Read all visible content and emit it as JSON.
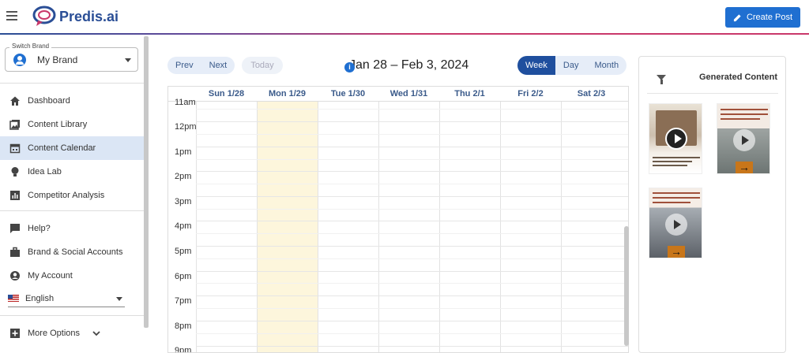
{
  "header": {
    "brand": "Predis.ai",
    "create_post": "Create Post"
  },
  "sidebar": {
    "switch_label": "Switch Brand",
    "brand": "My Brand",
    "items": [
      {
        "label": "Dashboard",
        "icon": "home-icon"
      },
      {
        "label": "Content Library",
        "icon": "image-library-icon"
      },
      {
        "label": "Content Calendar",
        "icon": "calendar-icon",
        "active": true
      },
      {
        "label": "Idea Lab",
        "icon": "lightbulb-icon"
      },
      {
        "label": "Competitor Analysis",
        "icon": "analytics-icon"
      },
      {
        "label": "Help?",
        "icon": "chat-icon"
      },
      {
        "label": "Brand & Social Accounts",
        "icon": "briefcase-icon"
      },
      {
        "label": "My Account",
        "icon": "account-icon"
      }
    ],
    "language": "English",
    "more_options": "More Options"
  },
  "calendar": {
    "prev": "Prev",
    "next": "Next",
    "today": "Today",
    "title": "Jan 28 – Feb 3, 2024",
    "views": [
      "Week",
      "Day",
      "Month"
    ],
    "active_view": "Week",
    "days": [
      "Sun 1/28",
      "Mon 1/29",
      "Tue 1/30",
      "Wed 1/31",
      "Thu 2/1",
      "Fri 2/2",
      "Sat 2/3"
    ],
    "today_day": "Mon 1/29",
    "times": [
      "11am",
      "12pm",
      "1pm",
      "2pm",
      "3pm",
      "4pm",
      "5pm",
      "6pm",
      "7pm",
      "8pm",
      "9pm"
    ]
  },
  "panel": {
    "title": "Generated Content"
  },
  "colors": {
    "accent": "#1f6fd1",
    "active_view": "#1f4f9e",
    "today_column": "#fdf6dc",
    "active_nav": "#dbe6f5"
  }
}
